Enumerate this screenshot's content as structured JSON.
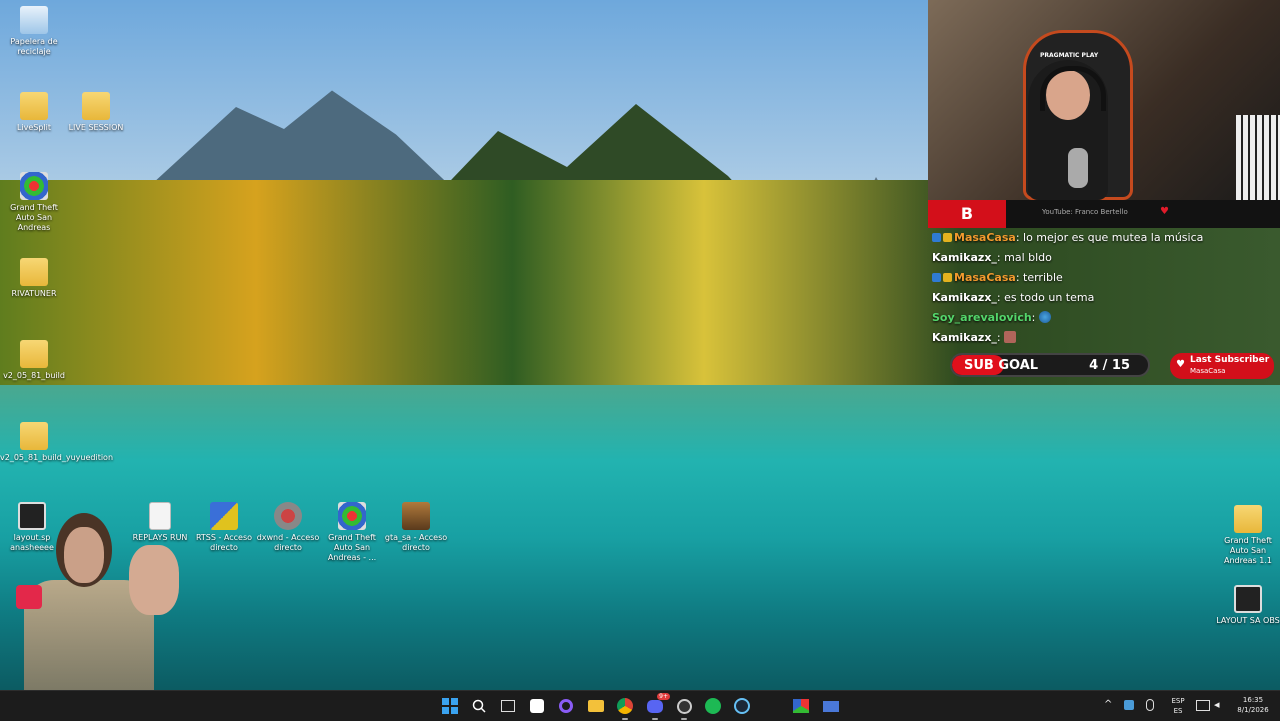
{
  "desktop": {
    "left_icons": [
      {
        "label": "Papelera de reciclaje",
        "icon": "recycle-bin-icon"
      },
      {
        "label": "LiveSplit",
        "icon": "folder-icon"
      },
      {
        "label": "LIVE SESSION",
        "icon": "folder-icon"
      },
      {
        "label": "Grand Theft Auto San Andreas",
        "icon": "app-icon"
      },
      {
        "label": "RIVATUNER",
        "icon": "folder-icon"
      },
      {
        "label": "v2_05_81_build",
        "icon": "folder-icon"
      },
      {
        "label": "v2_05_81_build_yuyuedition",
        "icon": "folder-icon"
      }
    ],
    "bottom_icons": [
      {
        "label": "layout.sp anasheeee",
        "icon": "obs-icon"
      },
      {
        "label": "REPLAYS RUN",
        "icon": "document-icon"
      },
      {
        "label": "RTSS - Acceso directo",
        "icon": "rtss-icon"
      },
      {
        "label": "dxwnd - Acceso directo",
        "icon": "dxwnd-icon"
      },
      {
        "label": "Grand Theft Auto San Andreas - ...",
        "icon": "app-icon"
      },
      {
        "label": "gta_sa - Acceso directo",
        "icon": "gta-icon"
      }
    ],
    "right_icons": [
      {
        "label": "Grand Theft Auto San Andreas 1.1",
        "icon": "folder-icon"
      },
      {
        "label": "LAYOUT SA OBS",
        "icon": "obs-icon"
      }
    ]
  },
  "stream": {
    "webcam_brand": "PRAGMATIC PLAY",
    "logo_text": "B",
    "youtube_text": "YouTube: Franco Bertello",
    "chat": [
      {
        "user": "MasaCasa",
        "msg": ": lo mejor es que mutea la música",
        "color": "orange",
        "badges": true
      },
      {
        "user": "Kamikazx_",
        "msg": ": mal bldo",
        "color": "white",
        "badges": false
      },
      {
        "user": "MasaCasa",
        "msg": ": terrible",
        "color": "orange",
        "badges": true
      },
      {
        "user": "Kamikazx_",
        "msg": ": es todo un tema",
        "color": "white",
        "badges": false
      },
      {
        "user": "Soy_arevalovich",
        "msg": ":",
        "color": "green",
        "badges": false,
        "emote": true
      },
      {
        "user": "Kamikazx_",
        "msg": ":",
        "color": "white",
        "badges": false,
        "emote": true
      }
    ],
    "sub_goal": {
      "label": "SUB GOAL",
      "current": 4,
      "target": 15,
      "count_text": "4 / 15"
    },
    "last_subscriber": {
      "title": "Last Subscriber",
      "name": "MasaCasa"
    }
  },
  "taskbar": {
    "icons": [
      "windows-start-icon",
      "search-icon",
      "task-view-icon",
      "store-icon",
      "cortana-icon",
      "file-explorer-icon",
      "chrome-icon",
      "discord-icon",
      "obs-studio-icon",
      "spotify-icon",
      "steam-icon",
      "rockstar-launcher-icon",
      "monitor-app-icon"
    ],
    "discord_badge": "9+",
    "tray": {
      "lang_top": "ESP",
      "lang_bottom": "ES",
      "time": "16:35",
      "date": "8/1/2026"
    }
  },
  "colors": {
    "accent_red": "#d30f1a",
    "taskbar": "#1c1c1c"
  }
}
